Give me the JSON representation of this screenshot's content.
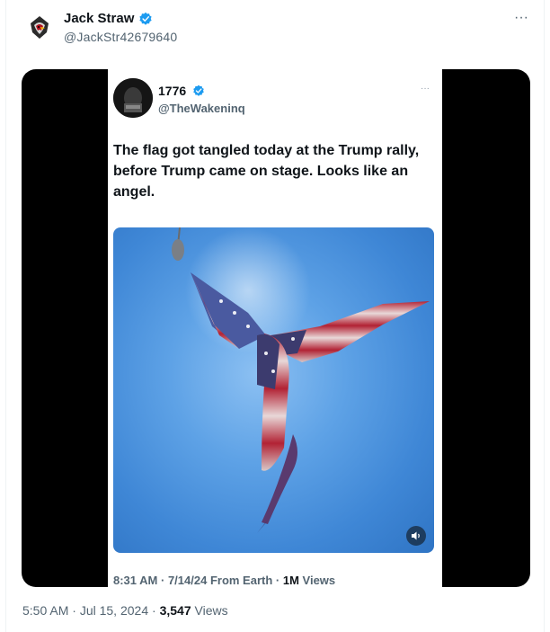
{
  "tweet": {
    "author": {
      "name": "Jack Straw",
      "handle": "@JackStr42679640",
      "verified": true,
      "avatar_icon": "cardinal-bird-avatar-icon"
    },
    "more_icon": "ellipsis-icon",
    "more_label": "···",
    "timestamp_time": "5:50 AM",
    "timestamp_date": "Jul 15, 2024",
    "views_count": "3,547",
    "views_label": "Views",
    "separator": " · "
  },
  "quoted": {
    "author": {
      "name": "1776",
      "handle": "@TheWakeninq",
      "verified": true
    },
    "more_label": "···",
    "text": "The flag got tangled today at the Trump rally, before Trump came on stage. Looks like an angel.",
    "media_icon": "mute-speaker-icon",
    "meta_time": "8:31 AM",
    "meta_date": "7/14/24",
    "meta_source": "From Earth",
    "meta_views_count": "1M",
    "meta_views_label": "Views",
    "meta_sep": " · "
  },
  "colors": {
    "verified": "#1d9bf0",
    "text": "#0f1419",
    "secondary": "#536471",
    "sky": "#5ea2e6",
    "flag_red": "#b22234",
    "flag_blue": "#3c3b6e"
  }
}
